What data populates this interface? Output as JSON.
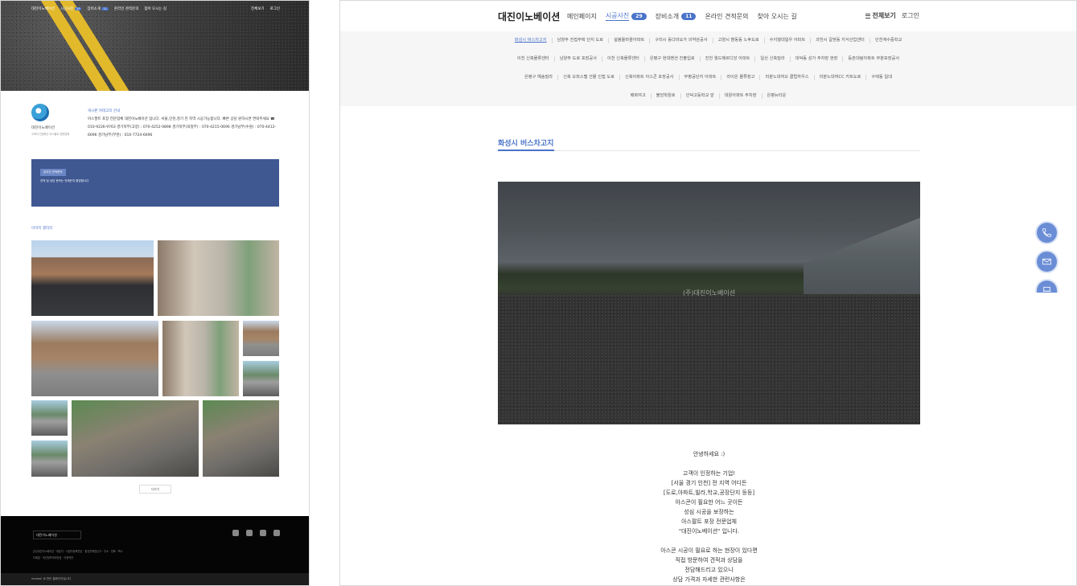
{
  "left_preview": {
    "nav": {
      "brand": "대진이노베이션",
      "items": [
        "시공사진",
        "장비소개",
        "온라인 견적문의",
        "찾아 오시는 길"
      ],
      "badges": [
        "29",
        "11"
      ],
      "right": [
        "전체보기",
        "로그인"
      ]
    },
    "intro": {
      "company": "대진이노베이션",
      "company_sub": "고객이 인정하는 아스팔트 전문업체",
      "lead": "게시판 카테고리 안내",
      "body": "아스팔트 포장 전문업체 대진이노베이션 입니다. 서울,인천,경기 전 지역 시공가능합니다. 빠른 상담 원하시면 연락주세요 ☎ 010-9226-9763 경기북부(고양) : 070-4252-0898 경기북부(의정부) : 070-4215-0696 경기남부(수원) : 070-4412-6696 경기남부(부천) : 010-7724-6696"
    },
    "blue_box": {
      "tag": "온라인 견적문의",
      "text": "견적 및 상담 문의는 언제든지 환영합니다"
    },
    "gallery_title": "이미지 갤러리",
    "more_button": "더보기",
    "footer": {
      "logo": "대진이노베이션",
      "info": [
        "[주]대진이노베이션 · 대표자 · 사업자등록번호 · 통신판매업신고 · 주소 · 전화 · 팩스",
        "이메일 · 개인정보처리방침 · 이용약관"
      ],
      "bar": "modoo! 로 만든 홈페이지입니다"
    }
  },
  "topbar": {
    "brand": "대진이노베이션",
    "nav": [
      {
        "label": "메인페이지",
        "badge": null,
        "active": false
      },
      {
        "label": "시공사진",
        "badge": "29",
        "active": true
      },
      {
        "label": "장비소개",
        "badge": "11",
        "active": false
      },
      {
        "label": "온라인 견적문의",
        "badge": null,
        "active": false
      },
      {
        "label": "찾아 오시는 길",
        "badge": null,
        "active": false
      }
    ],
    "menu_all": "전체보기",
    "login": "로그인"
  },
  "categories": [
    [
      "화성시 버스차고지",
      "남양주 진접주택 단지 도로",
      "설봉들마을아파트",
      "구리시 동다마요가 의약관공사",
      "고양시 향동동 노후도로",
      "수지행대일우 아파트",
      "과천시 갈현동 지식산업센터",
      "인천계수중학교"
    ],
    [
      "이천 신축물류센터",
      "남양주 도로 포장공사",
      "이천 신축물류센터",
      "은평구 현대벤션 진출입로",
      "진천 월드메르디앙 아파트",
      "일산 신축빌라",
      "대덕동 성가 주차장 현장",
      "등촌대림아파트 부분포장공사"
    ],
    [
      "은평구 예송빌라",
      "신축 오피스텔 건물 인접 도로",
      "신축아파트 아스콘 포장공사",
      "부평공단지 아파트",
      "라이온 물류창고",
      "미분노대여오 클럽하우스",
      "미분노대여CC 카트도로",
      "수택동 일대"
    ],
    [
      "배화여고",
      "불암학원로",
      "인덕고등학교 앞",
      "대원아파트 주차장",
      "은평뉴타운"
    ]
  ],
  "active_category": "화성시 버스차고지",
  "section_title": "화성시 버스차고지",
  "photo_watermark": "(주)대진이노베이션",
  "article": [
    "안녕하세요 :)",
    "",
    "고객이 인정하는 기업!",
    "[서울 경기 인천] 전 지역 어디든",
    "[도로,아파트,빌라,학교,공장단지 등등]",
    "아스콘이 필요한 어느 곳이든",
    "성심 시공을 보장하는",
    "아스팔트 포장 전문업체",
    "\"대진이노베이션\" 입니다.",
    "",
    "아스콘 시공이 필요로 하는 현장이 있다면",
    "직접 방문하여 견적과 상담을",
    "전담해드리고 있으니",
    "상담 가격과 자세한 관련사항은"
  ],
  "fab_icons": [
    "phone-icon",
    "mail-icon",
    "print-icon"
  ],
  "colors": {
    "accent": "#4a73c9",
    "fab": "#6a8dd6",
    "box": "#3f5892",
    "footer": "#050505"
  }
}
